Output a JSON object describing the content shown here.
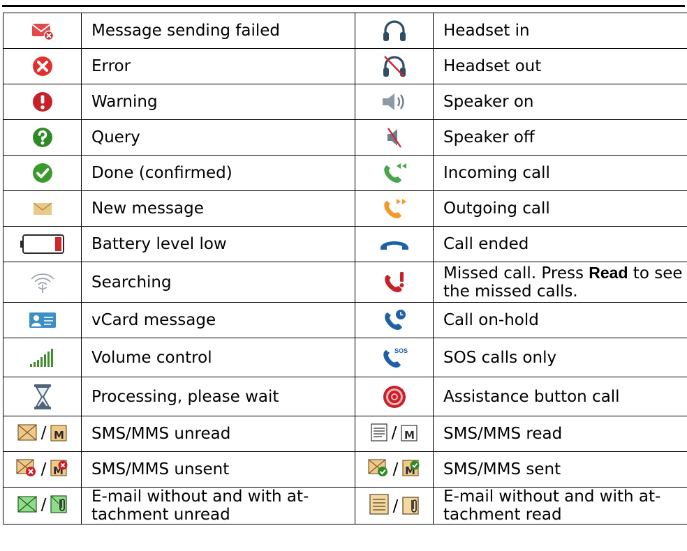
{
  "colors": {
    "error_red": "#e0312f",
    "query_green": "#2f8a26",
    "done_green": "#3a9b2d",
    "call_green": "#49a64a",
    "call_orange": "#f39a2a",
    "call_blue": "#1f5fa8",
    "missed_red": "#c8202a",
    "volume_green": "#3f8f2a",
    "envelope_tan": "#e9c985"
  },
  "rows": [
    {
      "left": {
        "icon": "message-failed-icon",
        "label": "Message sending failed"
      },
      "right": {
        "icon": "headset-in-icon",
        "label": "Headset in"
      }
    },
    {
      "left": {
        "icon": "error-icon",
        "label": "Error"
      },
      "right": {
        "icon": "headset-out-icon",
        "label": "Headset out"
      }
    },
    {
      "left": {
        "icon": "warning-icon",
        "label": "Warning"
      },
      "right": {
        "icon": "speaker-on-icon",
        "label": "Speaker on"
      }
    },
    {
      "left": {
        "icon": "query-icon",
        "label": "Query"
      },
      "right": {
        "icon": "speaker-off-icon",
        "label": "Speaker off"
      }
    },
    {
      "left": {
        "icon": "done-icon",
        "label": "Done (confirmed)"
      },
      "right": {
        "icon": "incoming-call-icon",
        "label": "Incoming call"
      }
    },
    {
      "left": {
        "icon": "new-message-icon",
        "label": "New message"
      },
      "right": {
        "icon": "outgoing-call-icon",
        "label": "Outgoing call"
      }
    },
    {
      "left": {
        "icon": "battery-low-icon",
        "label": "Battery level low"
      },
      "right": {
        "icon": "call-ended-icon",
        "label": "Call ended"
      }
    },
    {
      "left": {
        "icon": "searching-icon",
        "label": "Searching"
      },
      "right": {
        "icon": "missed-call-icon",
        "label_pre": "Missed call. Press ",
        "label_bold": "Read",
        "label_post": " to see the missed calls."
      }
    },
    {
      "left": {
        "icon": "vcard-icon",
        "label": "vCard message"
      },
      "right": {
        "icon": "call-on-hold-icon",
        "label": "Call on-hold"
      }
    },
    {
      "left": {
        "icon": "volume-control-icon",
        "label": "Volume control"
      },
      "right": {
        "icon": "sos-call-icon",
        "label": "SOS calls only"
      }
    },
    {
      "left": {
        "icon": "hourglass-icon",
        "label": "Processing, please wait"
      },
      "right": {
        "icon": "assistance-button-icon",
        "label": "Assistance button call"
      }
    },
    {
      "left": {
        "icon": "sms-mms-unread-icon",
        "label": "SMS/MMS unread"
      },
      "right": {
        "icon": "sms-mms-read-icon",
        "label": "SMS/MMS read"
      }
    },
    {
      "left": {
        "icon": "sms-mms-unsent-icon",
        "label": "SMS/MMS unsent"
      },
      "right": {
        "icon": "sms-mms-sent-icon",
        "label": "SMS/MMS sent"
      }
    },
    {
      "left": {
        "icon": "email-unread-icon",
        "label": "E-mail without and with at-\ntachment unread"
      },
      "right": {
        "icon": "email-read-icon",
        "label": "E-mail without and with at-\ntachment read"
      }
    }
  ],
  "pair_separator": "/",
  "sos_text": "SOS",
  "mms_letter": "M"
}
